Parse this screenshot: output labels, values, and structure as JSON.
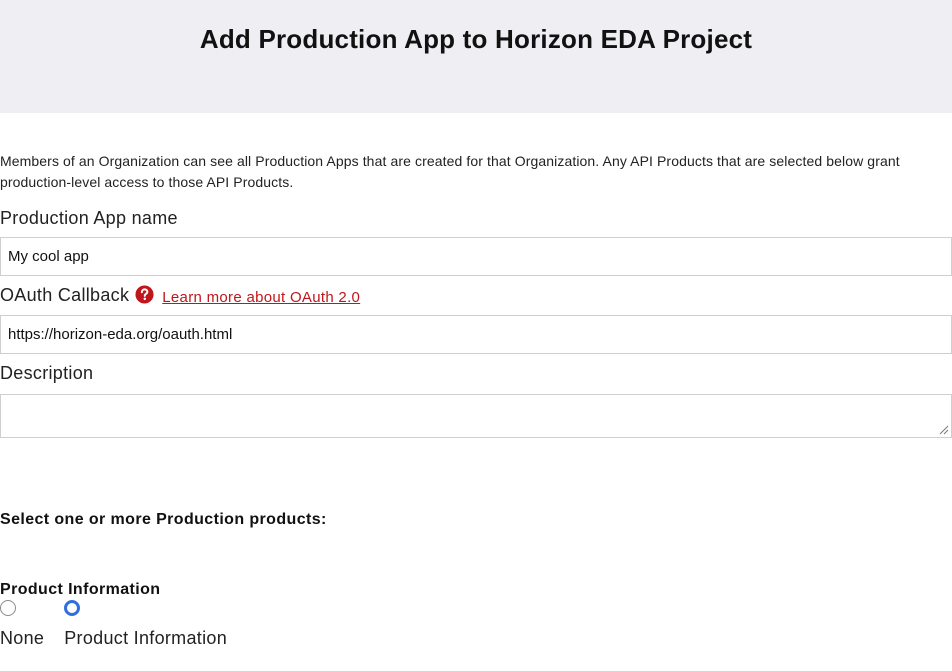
{
  "header": {
    "title": "Add Production App to Horizon EDA Project"
  },
  "intro": {
    "text": "Members of an Organization can see all Production Apps that are created for that Organization. Any API Products that are selected below grant production-level access to those API Products."
  },
  "form": {
    "app_name_label": "Production App name",
    "app_name_value": "My cool app",
    "oauth_label": "OAuth Callback",
    "oauth_help_icon": "question-circle-icon",
    "oauth_link": "Learn more about OAuth 2.0",
    "oauth_value": "https://horizon-eda.org/oauth.html",
    "description_label": "Description",
    "description_value": ""
  },
  "products": {
    "select_heading": "Select one or more Production products:",
    "group_title": "Product Information",
    "options": [
      {
        "label": "None",
        "selected": false
      },
      {
        "label": "Product Information",
        "selected": true
      }
    ]
  },
  "colors": {
    "header_bg": "#efeef2",
    "link": "#c0161b",
    "radio_selected": "#2f6fdf"
  }
}
